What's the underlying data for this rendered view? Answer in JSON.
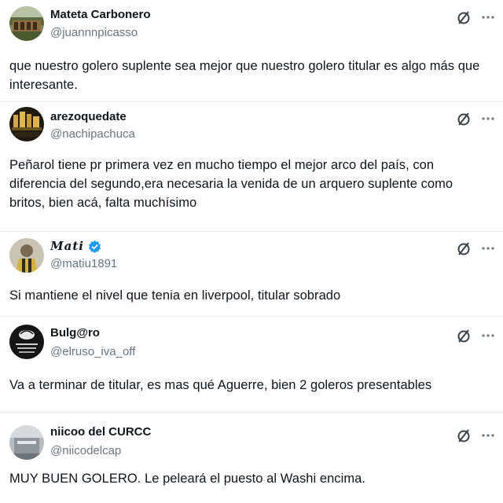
{
  "tweets": [
    {
      "display_name": "Mateta Carbonero",
      "handle": "@juannnpicasso",
      "verified": false,
      "avatar_icon": "stadium-avatar",
      "text": "que nuestro golero suplente sea mejor que nuestro golero titular es algo más que interesante."
    },
    {
      "display_name": "arezoquedate",
      "handle": "@nachipachuca",
      "verified": false,
      "avatar_icon": "trophies-avatar",
      "text": "Peñarol tiene pr primera vez en mucho tiempo el mejor arco del país, con diferencia del segundo,era necesaria la venida de un arquero suplente como britos, bien acá, falta muchísimo"
    },
    {
      "display_name": "𝑴𝒂𝒕𝒊",
      "handle": "@matiu1891",
      "verified": true,
      "avatar_icon": "player-avatar",
      "text": "Si mantiene el nivel que tenia en liverpool, titular sobrado"
    },
    {
      "display_name": "Bulg@ro",
      "handle": "@elruso_iva_off",
      "verified": false,
      "avatar_icon": "dark-text-avatar",
      "text": "Va a terminar de titular, es mas qué Aguerre, bien 2 goleros presentables"
    },
    {
      "display_name": "niicoo del CURCC",
      "handle": "@niicodelcap",
      "verified": false,
      "avatar_icon": "grey-photo-avatar",
      "text": "MUY BUEN GOLERO. Le peleará el puesto al Washi encima."
    }
  ],
  "colors": {
    "text": "#0f1419",
    "secondary": "#6b757d",
    "verified": "#1d9bf0",
    "divider": "#e6e9ec"
  },
  "icons": {
    "action_1": "grok-slash-icon",
    "action_2": "more-icon"
  }
}
